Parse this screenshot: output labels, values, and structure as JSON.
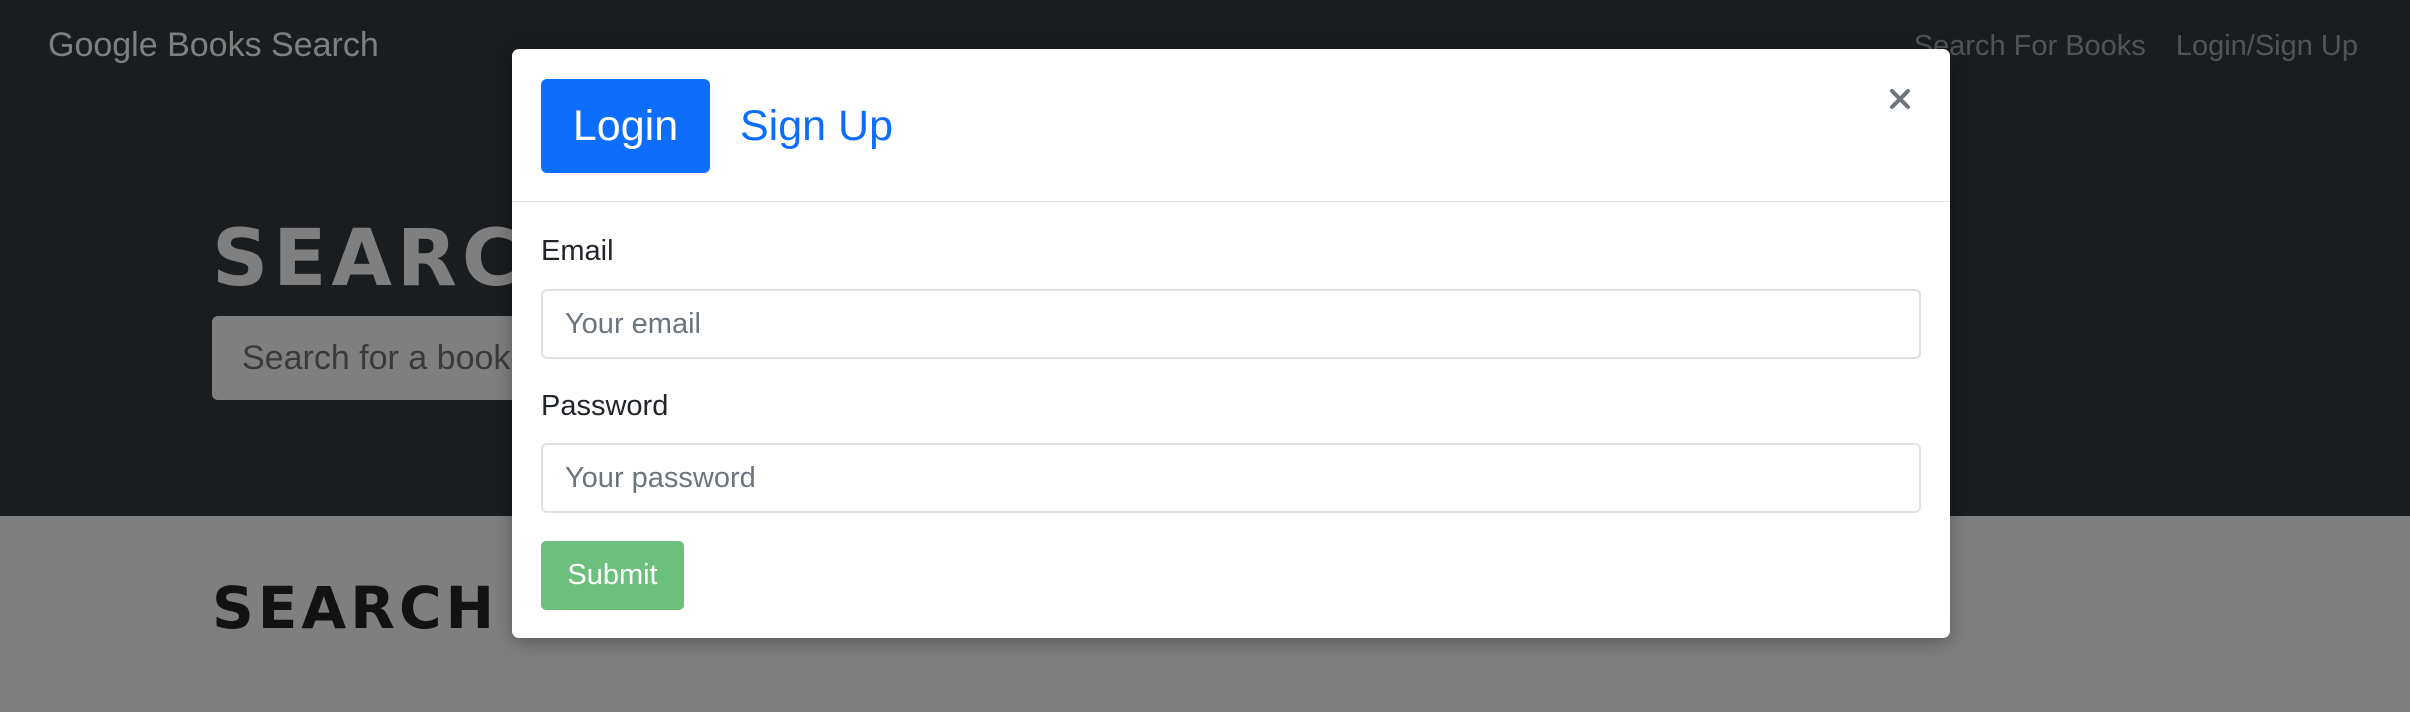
{
  "navbar": {
    "brand": "Google Books Search",
    "links": [
      "Search For Books",
      "Login/Sign Up"
    ]
  },
  "hero": {
    "heading": "SEARCH FOR BOOKS!",
    "search_placeholder": "Search for a book"
  },
  "results": {
    "heading": "SEARCH FOR A BOOK TO BEGIN"
  },
  "modal": {
    "tabs": {
      "login": "Login",
      "signup": "Sign Up",
      "active": "login"
    },
    "close_glyph": "×",
    "email_label": "Email",
    "email_placeholder": "Your email",
    "email_value": "",
    "password_label": "Password",
    "password_placeholder": "Your password",
    "password_value": "",
    "submit_label": "Submit"
  },
  "colors": {
    "navbar_bg": "#343a40",
    "primary": "#0d6efd",
    "submit_disabled": "#6cbf7c",
    "backdrop": "rgba(0,0,0,0.5)"
  }
}
